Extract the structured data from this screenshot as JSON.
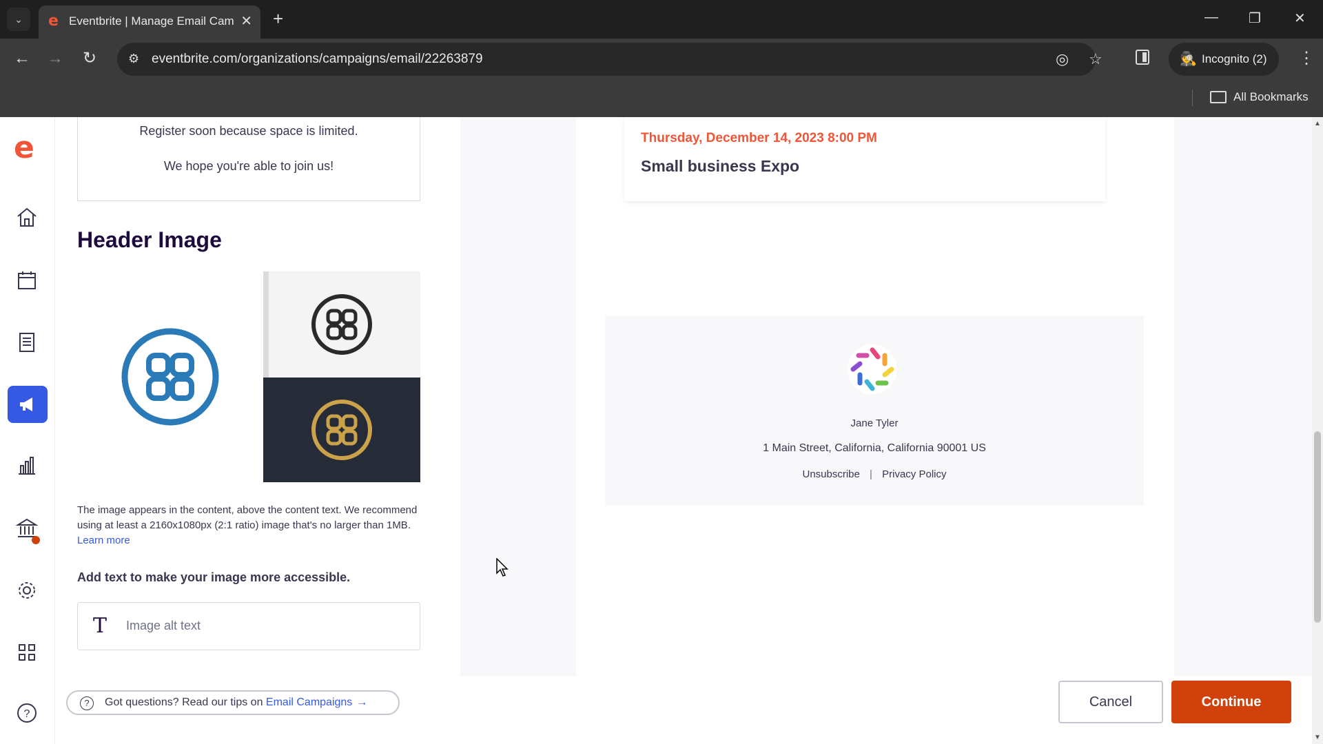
{
  "browser": {
    "tab_title": "Eventbrite | Manage Email Campaigns",
    "url": "eventbrite.com/organizations/campaigns/email/22263879",
    "incognito_label": "Incognito (2)",
    "bookmarks_label": "All Bookmarks"
  },
  "sidebar": {
    "items": [
      "home",
      "events",
      "orders",
      "marketing",
      "reports",
      "finance",
      "settings",
      "app-marketplace",
      "help"
    ],
    "active": "marketing"
  },
  "editor": {
    "message_line1": "Register soon because space is limited.",
    "message_line2": "We hope you're able to join us!",
    "header_image_title": "Header Image",
    "help_text": "The image appears in the content, above the content text. We recommend using at least a 2160x1080px (2:1 ratio) image that's no larger than 1MB.",
    "learn_more": "Learn more",
    "alt_label": "Add text to make your image more accessible.",
    "alt_placeholder": "Image alt text"
  },
  "preview": {
    "event_date": "Thursday, December 14, 2023 8:00 PM",
    "event_name": "Small business Expo",
    "organizer_name": "Jane Tyler",
    "organizer_address": "1 Main Street, California, California 90001 US",
    "unsubscribe": "Unsubscribe",
    "privacy_policy": "Privacy Policy"
  },
  "footer": {
    "tips_prefix": "Got questions? Read our tips on ",
    "tips_link": "Email Campaigns",
    "cancel": "Cancel",
    "continue": "Continue"
  },
  "colors": {
    "brand": "#f05537",
    "primary_button": "#d1410c",
    "link": "#3659e3",
    "active_nav": "#3659e3"
  }
}
